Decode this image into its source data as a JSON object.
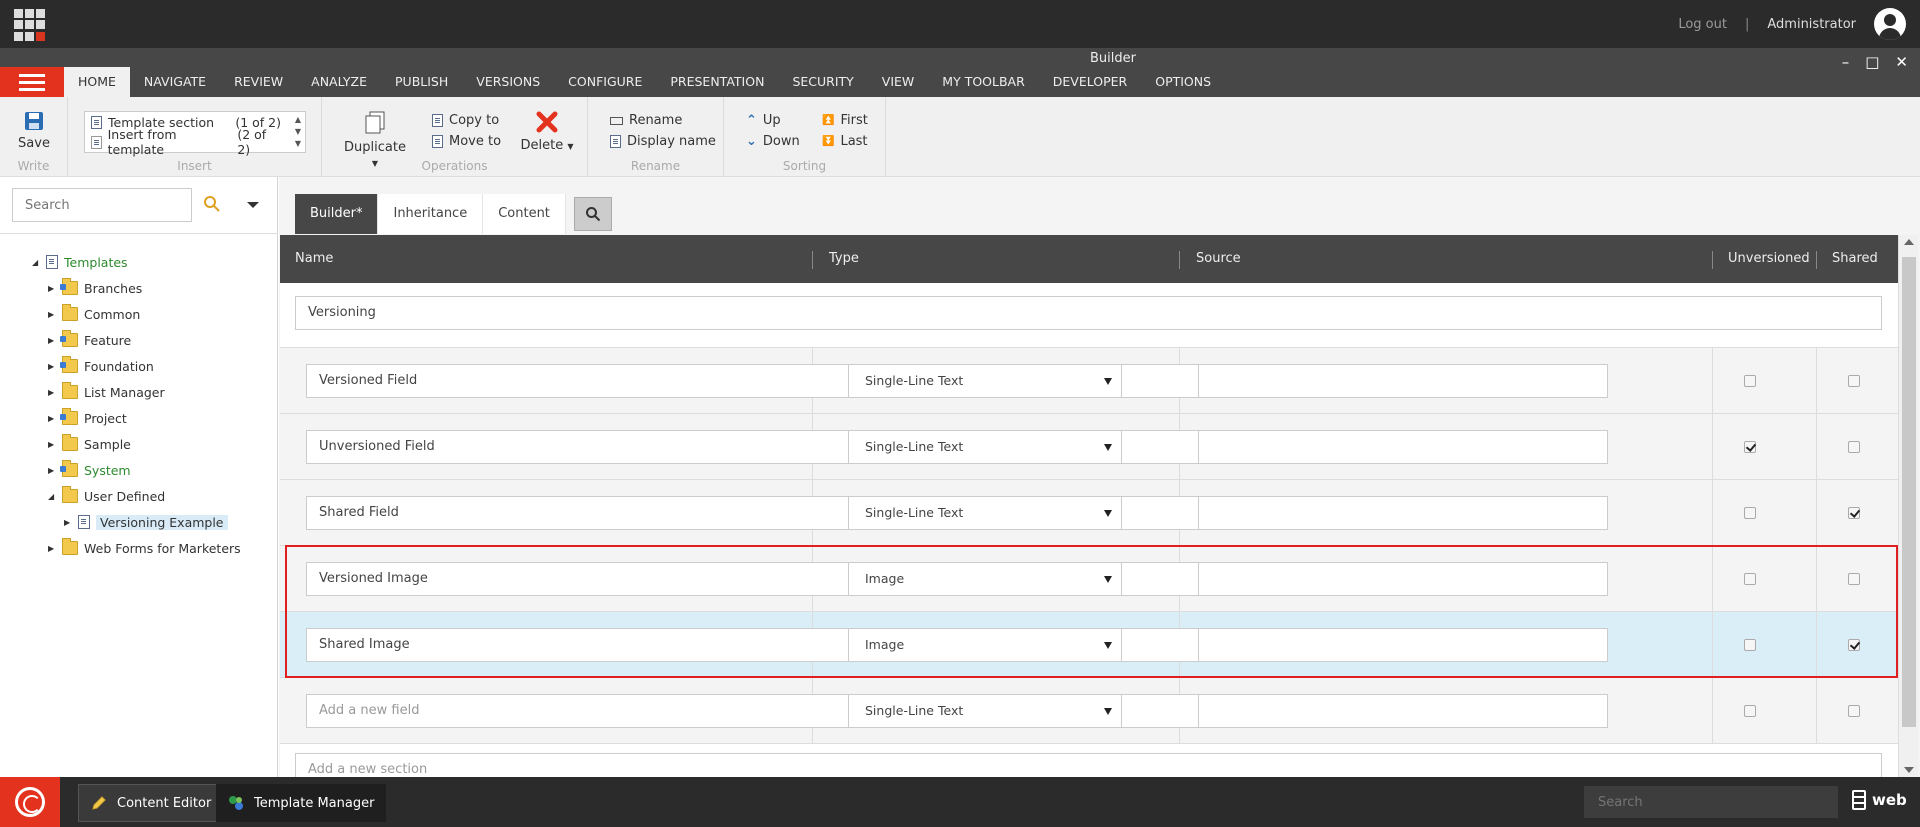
{
  "topbar": {
    "logout": "Log out",
    "separator": "|",
    "user": "Administrator"
  },
  "window": {
    "title": "Builder",
    "minimize": "–",
    "maximize": "□",
    "close": "✕"
  },
  "ribbon_tabs": [
    "HOME",
    "NAVIGATE",
    "REVIEW",
    "ANALYZE",
    "PUBLISH",
    "VERSIONS",
    "CONFIGURE",
    "PRESENTATION",
    "SECURITY",
    "VIEW",
    "MY TOOLBAR",
    "DEVELOPER",
    "OPTIONS"
  ],
  "ribbon": {
    "write": {
      "save": "Save",
      "label": "Write"
    },
    "insert": {
      "items": [
        {
          "label": "Template section",
          "count": "(1 of 2)"
        },
        {
          "label": "Insert from template",
          "count": "(2 of 2)"
        }
      ],
      "label": "Insert"
    },
    "operations": {
      "duplicate": "Duplicate",
      "copy_to": "Copy to",
      "move_to": "Move to",
      "delete": "Delete",
      "label": "Operations"
    },
    "rename": {
      "rename": "Rename",
      "display_name": "Display name",
      "label": "Rename"
    },
    "sorting": {
      "up": "Up",
      "down": "Down",
      "first": "First",
      "last": "Last",
      "label": "Sorting"
    }
  },
  "left_panel": {
    "search_placeholder": "Search",
    "tree": [
      {
        "label": "Templates",
        "level": 0,
        "expanded": true,
        "green": true
      },
      {
        "label": "Branches",
        "level": 1
      },
      {
        "label": "Common",
        "level": 1
      },
      {
        "label": "Feature",
        "level": 1
      },
      {
        "label": "Foundation",
        "level": 1
      },
      {
        "label": "List Manager",
        "level": 1
      },
      {
        "label": "Project",
        "level": 1
      },
      {
        "label": "Sample",
        "level": 1
      },
      {
        "label": "System",
        "level": 1,
        "green": true
      },
      {
        "label": "User Defined",
        "level": 1,
        "expanded": true
      },
      {
        "label": "Versioning Example",
        "level": 2,
        "selected": true
      },
      {
        "label": "Web Forms for Marketers",
        "level": 1
      }
    ]
  },
  "subtabs": [
    "Builder*",
    "Inheritance",
    "Content"
  ],
  "grid": {
    "headers": {
      "name": "Name",
      "type": "Type",
      "source": "Source",
      "unversioned": "Unversioned",
      "shared": "Shared"
    },
    "section": "Versioning",
    "fields": [
      {
        "name": "Versioned Field",
        "type": "Single-Line Text",
        "source": "",
        "unversioned": false,
        "shared": false,
        "highlight": false
      },
      {
        "name": "Unversioned Field",
        "type": "Single-Line Text",
        "source": "",
        "unversioned": true,
        "shared": false,
        "highlight": false
      },
      {
        "name": "Shared Field",
        "type": "Single-Line Text",
        "source": "",
        "unversioned": false,
        "shared": true,
        "highlight": false
      },
      {
        "name": "Versioned Image",
        "type": "Image",
        "source": "",
        "unversioned": false,
        "shared": false,
        "highlight": false
      },
      {
        "name": "Shared Image",
        "type": "Image",
        "source": "",
        "unversioned": false,
        "shared": true,
        "highlight": true
      }
    ],
    "new_field": {
      "placeholder": "Add a new field",
      "type": "Single-Line Text"
    },
    "new_section_placeholder": "Add a new section"
  },
  "taskbar": {
    "apps": [
      "Content Editor",
      "Template Manager"
    ],
    "search_placeholder": "Search",
    "database": "web"
  }
}
